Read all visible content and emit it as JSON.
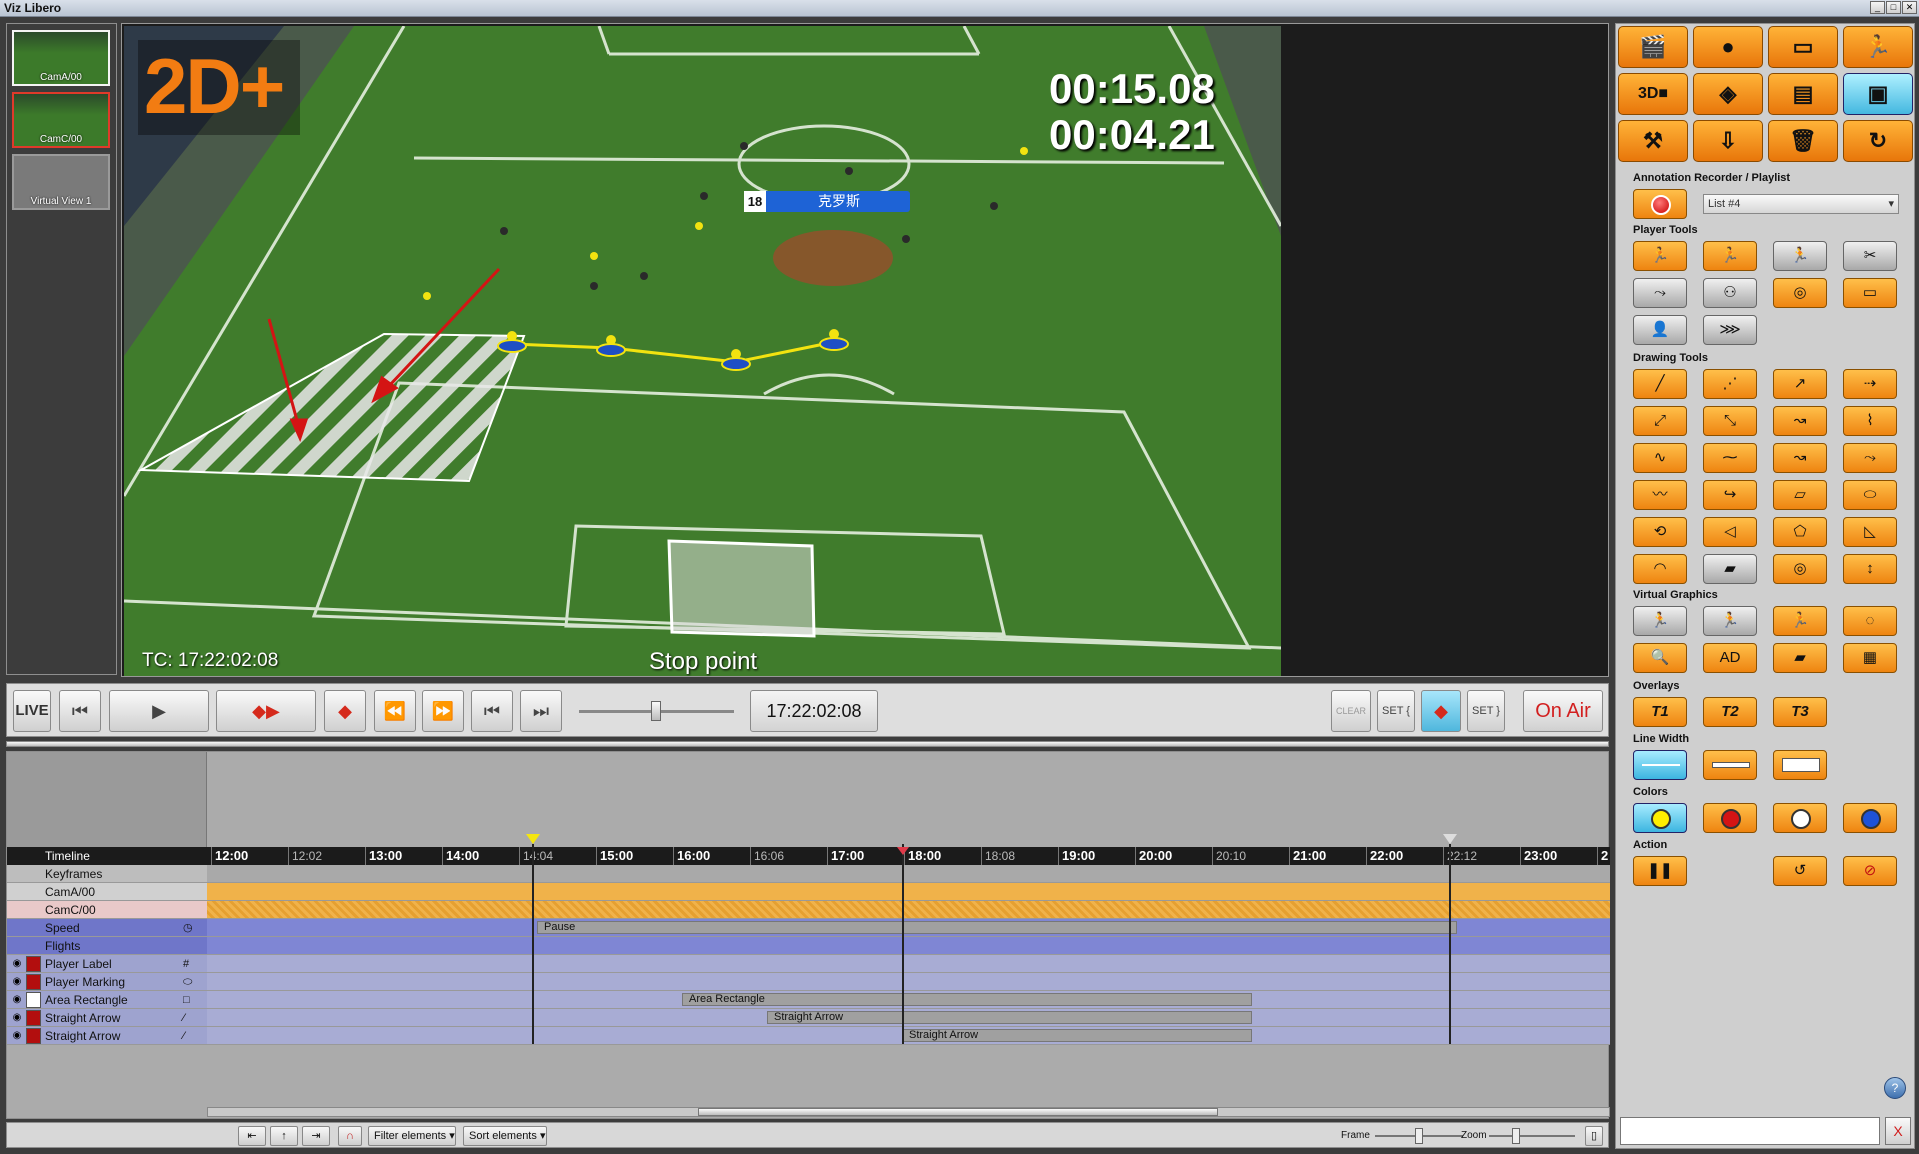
{
  "window": {
    "title": "Viz Libero",
    "buttons": [
      "_",
      "□",
      "✕"
    ]
  },
  "thumbnails": [
    {
      "label": "CamA/00"
    },
    {
      "label": "CamC/00"
    },
    {
      "label": "Virtual View 1"
    }
  ],
  "viewer": {
    "badge": "2D+",
    "clock_top": "00:15.08",
    "clock_bottom": "00:04.21",
    "timecode_label": "TC: 17:22:02:08",
    "stop_label": "Stop point",
    "player_number": "18",
    "player_name": "克罗斯"
  },
  "transport": {
    "live": "LIVE",
    "timecode": "17:22:02:08",
    "on_air": "On Air",
    "clear": "CLEAR",
    "set_in": "SET {",
    "set_out": "SET }"
  },
  "timeline": {
    "header": "Timeline",
    "ticks": [
      {
        "label": "12:00",
        "major": true
      },
      {
        "label": "12:02",
        "major": false
      },
      {
        "label": "13:00",
        "major": true
      },
      {
        "label": "14:00",
        "major": true
      },
      {
        "label": "14:04",
        "major": false
      },
      {
        "label": "15:00",
        "major": true
      },
      {
        "label": "16:00",
        "major": true
      },
      {
        "label": "16:06",
        "major": false
      },
      {
        "label": "17:00",
        "major": true
      },
      {
        "label": "18:00",
        "major": true
      },
      {
        "label": "18:08",
        "major": false
      },
      {
        "label": "19:00",
        "major": true
      },
      {
        "label": "20:00",
        "major": true
      },
      {
        "label": "20:10",
        "major": false
      },
      {
        "label": "21:00",
        "major": true
      },
      {
        "label": "22:00",
        "major": true
      },
      {
        "label": "22:12",
        "major": false
      },
      {
        "label": "23:00",
        "major": true
      },
      {
        "label": "2",
        "major": true
      }
    ],
    "rows": [
      {
        "label": "Keyframes",
        "color": "#bdbdbd",
        "track": "#a9a9a9"
      },
      {
        "label": "CamA/00",
        "color": "#d0d0d0",
        "track": "#f0b24a"
      },
      {
        "label": "CamC/00",
        "color": "#e9c9c9",
        "track": "#f0b24a"
      },
      {
        "label": "Speed",
        "color": "#6f76c9",
        "track": "#7f86d4",
        "icon": "◷"
      },
      {
        "label": "Flights",
        "color": "#6f76c9",
        "track": "#7f86d4"
      },
      {
        "label": "Player Label",
        "color": "#9ea3cf",
        "track": "#a8acd4",
        "icon": "#",
        "swatch": "#b20e0e"
      },
      {
        "label": "Player Marking",
        "color": "#9ea3cf",
        "track": "#a8acd4",
        "icon": "⬭",
        "swatch": "#b20e0e"
      },
      {
        "label": "Area Rectangle",
        "color": "#9ea3cf",
        "track": "#a8acd4",
        "icon": "□",
        "swatch": "#ffffff"
      },
      {
        "label": "Straight Arrow",
        "color": "#9ea3cf",
        "track": "#a8acd4",
        "icon": "⁄",
        "swatch": "#b20e0e"
      },
      {
        "label": "Straight Arrow",
        "color": "#9ea3cf",
        "track": "#a8acd4",
        "icon": "⁄",
        "swatch": "#b20e0e"
      }
    ],
    "bars": [
      {
        "row": 3,
        "label": "Pause"
      },
      {
        "row": 7,
        "label": "Area Rectangle"
      },
      {
        "row": 8,
        "label": "Straight Arrow"
      },
      {
        "row": 9,
        "label": "Straight Arrow"
      }
    ]
  },
  "bottombar": {
    "filter": "Filter elements",
    "sort": "Sort elements",
    "frame": "Frame",
    "zoom": "Zoom"
  },
  "right_panel": {
    "sections": {
      "recorder": "Annotation Recorder / Playlist",
      "player_tools": "Player Tools",
      "drawing_tools": "Drawing Tools",
      "virtual_graphics": "Virtual Graphics",
      "overlays": "Overlays",
      "line_width": "Line Width",
      "colors": "Colors",
      "action": "Action"
    },
    "playlist": "List #4",
    "overlay_labels": [
      "T1",
      "T2",
      "T3"
    ],
    "color_values": [
      "#ffee00",
      "#d41414",
      "#ffffff",
      "#1e52d8"
    ]
  }
}
